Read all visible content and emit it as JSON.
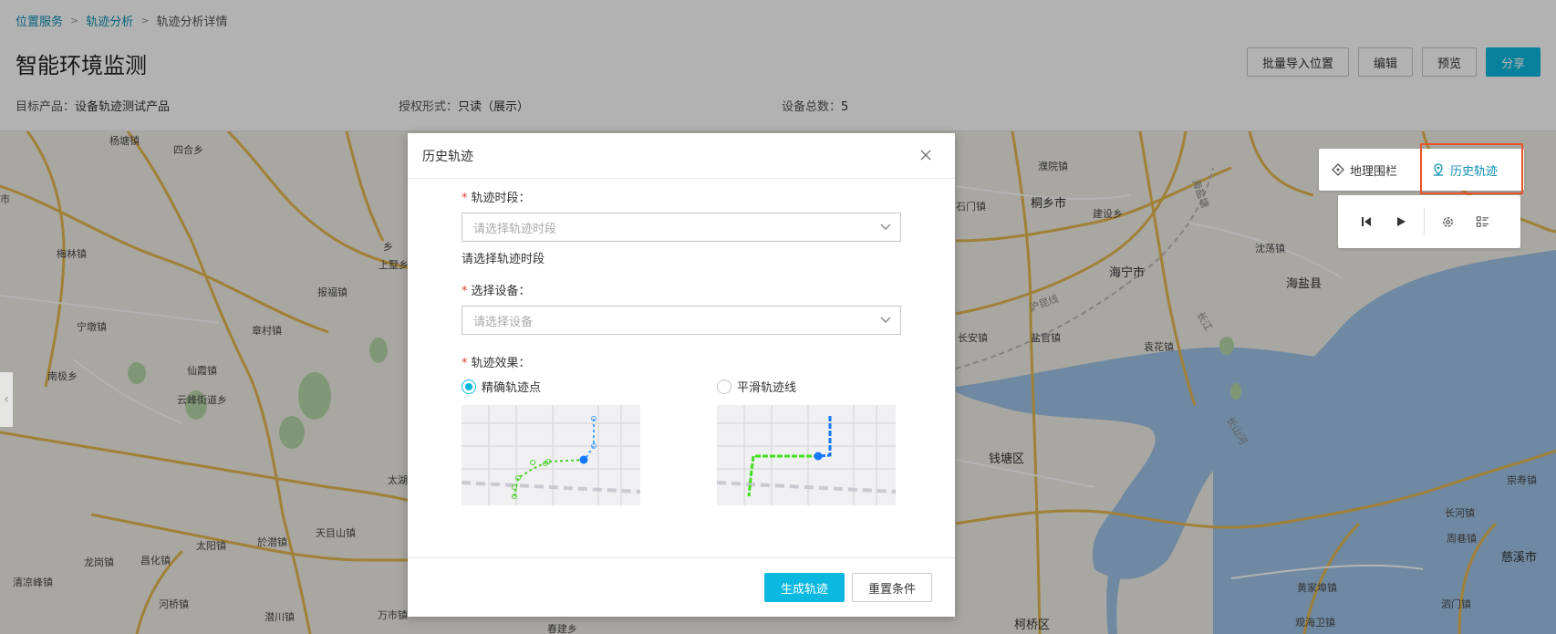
{
  "breadcrumb": {
    "items": [
      "位置服务",
      "轨迹分析"
    ],
    "current": "轨迹分析详情",
    "separator": ">"
  },
  "page": {
    "title": "智能环境监测",
    "meta": [
      {
        "label": "目标产品：",
        "value": "设备轨迹测试产品"
      },
      {
        "label": "授权形式：",
        "value": "只读（展示）"
      },
      {
        "label": "设备总数：",
        "value": "5"
      }
    ]
  },
  "actions": {
    "import": "批量导入位置",
    "edit": "编辑",
    "preview": "预览",
    "share": "分享"
  },
  "map_controls": {
    "tabs": [
      {
        "label": "地理围栏",
        "icon": "geofence-icon",
        "active": false
      },
      {
        "label": "历史轨迹",
        "icon": "location-pin-icon",
        "active": true
      }
    ],
    "player": [
      "skip-to-start-icon",
      "play-icon",
      "settings-icon",
      "list-icon"
    ]
  },
  "map_labels": [
    "杨塘镇",
    "四合乡",
    "梅林镇",
    "上墅乡",
    "报福镇",
    "宁墩镇",
    "章村镇",
    "南极乡",
    "仙霞镇",
    "云峰街道乡",
    "太湖",
    "太阳镇",
    "於潜镇",
    "天目山镇",
    "昌化镇",
    "龙岗镇",
    "清凉峰镇",
    "河桥镇",
    "潜川镇",
    "万市镇",
    "春建乡",
    "濮院镇",
    "桐乡市",
    "建设乡",
    "石门镇",
    "海宁市",
    "沈荡镇",
    "海盐县",
    "长安镇",
    "盐官镇",
    "袁花镇",
    "钱塘区",
    "柯桥区",
    "长河镇",
    "周巷镇",
    "慈溪市",
    "黄家埠镇",
    "崇寿镇",
    "泗门镇",
    "观海卫镇",
    "长江",
    "海盐塘",
    "沪昆线",
    "长山河",
    "市",
    "乡"
  ],
  "modal": {
    "title": "历史轨迹",
    "period_label": "轨迹时段：",
    "period_placeholder": "请选择轨迹时段",
    "period_hint": "请选择轨迹时段",
    "device_label": "选择设备：",
    "device_placeholder": "请选择设备",
    "effect_label": "轨迹效果：",
    "effect_options": [
      {
        "label": "精确轨迹点",
        "checked": true
      },
      {
        "label": "平滑轨迹线",
        "checked": false
      }
    ],
    "generate": "生成轨迹",
    "reset": "重置条件"
  },
  "colors": {
    "primary": "#0bb8e0",
    "link": "#0e8fb3",
    "highlight": "#e8542a",
    "required": "#e4393c"
  }
}
